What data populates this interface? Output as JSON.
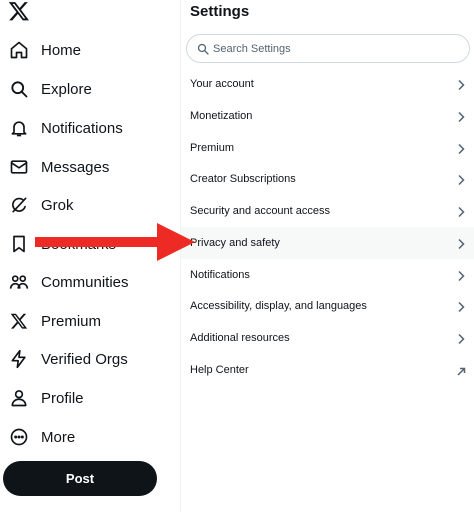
{
  "sidebar": {
    "logo_icon": "x-logo-icon",
    "items": [
      {
        "label": "Home",
        "icon": "home-icon"
      },
      {
        "label": "Explore",
        "icon": "search-icon"
      },
      {
        "label": "Notifications",
        "icon": "bell-icon"
      },
      {
        "label": "Messages",
        "icon": "envelope-icon"
      },
      {
        "label": "Grok",
        "icon": "grok-icon"
      },
      {
        "label": "Bookmarks",
        "icon": "bookmark-icon"
      },
      {
        "label": "Communities",
        "icon": "communities-icon"
      },
      {
        "label": "Premium",
        "icon": "x-logo-icon"
      },
      {
        "label": "Verified Orgs",
        "icon": "lightning-icon"
      },
      {
        "label": "Profile",
        "icon": "person-icon"
      },
      {
        "label": "More",
        "icon": "more-circle-icon"
      }
    ],
    "post_label": "Post"
  },
  "settings": {
    "title": "Settings",
    "search_placeholder": "Search Settings",
    "items": [
      {
        "label": "Your account",
        "icon": "chevron-right-icon"
      },
      {
        "label": "Monetization",
        "icon": "chevron-right-icon"
      },
      {
        "label": "Premium",
        "icon": "chevron-right-icon"
      },
      {
        "label": "Creator Subscriptions",
        "icon": "chevron-right-icon"
      },
      {
        "label": "Security and account access",
        "icon": "chevron-right-icon"
      },
      {
        "label": "Privacy and safety",
        "icon": "chevron-right-icon",
        "active": true
      },
      {
        "label": "Notifications",
        "icon": "chevron-right-icon"
      },
      {
        "label": "Accessibility, display, and languages",
        "icon": "chevron-right-icon"
      },
      {
        "label": "Additional resources",
        "icon": "chevron-right-icon"
      },
      {
        "label": "Help Center",
        "icon": "external-link-icon"
      }
    ]
  },
  "annotation": {
    "icon": "red-arrow-icon",
    "color": "#ee2a24"
  },
  "colors": {
    "text": "#0f1419",
    "muted": "#536471",
    "post_bg": "#0f1419",
    "hover": "#f7f9f9",
    "border": "#cfd9de"
  }
}
